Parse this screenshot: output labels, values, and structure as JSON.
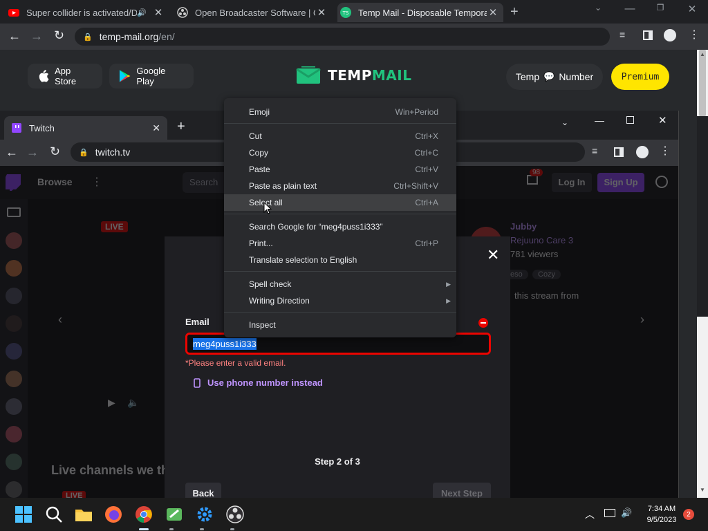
{
  "outer_tabs": [
    {
      "title": "Super collider is activated/De"
    },
    {
      "title": "Open Broadcaster Software | OBS"
    },
    {
      "title": "Temp Mail - Disposable Temporary Email"
    }
  ],
  "outer_url": {
    "host": "temp-mail.org",
    "path": "/en/"
  },
  "tempmail": {
    "app_store": "App Store",
    "google_play": "Google Play",
    "logo_a": "TEMP",
    "logo_b": "MAIL",
    "temp_number_a": "Temp",
    "temp_number_b": "Number",
    "premium": "Premium"
  },
  "inner_tab": {
    "title": "Twitch"
  },
  "inner_url": "twitch.tv",
  "twitch_bg": {
    "browse": "Browse",
    "search": "Search",
    "login": "Log In",
    "signup": "Sign Up",
    "badge": "98",
    "live": "LIVE",
    "streamer": "Jubby",
    "game": "Rejuuno Care 3",
    "viewers": "781 viewers",
    "tag1": "eso",
    "tag2": "Cozy",
    "stream_from": "this stream from",
    "live_channels": "Live channels we th",
    "live_badge2": "LIVE"
  },
  "modal": {
    "email_label": "Email",
    "email_value": "meg4puss1i333",
    "error": "*Please enter a valid email.",
    "phone_link": "Use phone number instead",
    "step": "Step 2 of 3",
    "back": "Back",
    "next": "Next Step"
  },
  "context_menu": [
    {
      "label": "Emoji",
      "shortcut": "Win+Period"
    },
    {
      "label": "Cut",
      "shortcut": "Ctrl+X"
    },
    {
      "label": "Copy",
      "shortcut": "Ctrl+C"
    },
    {
      "label": "Paste",
      "shortcut": "Ctrl+V"
    },
    {
      "label": "Paste as plain text",
      "shortcut": "Ctrl+Shift+V"
    },
    {
      "label": "Select all",
      "shortcut": "Ctrl+A"
    },
    {
      "label": "Search Google for “meg4puss1i333”",
      "shortcut": ""
    },
    {
      "label": "Print...",
      "shortcut": "Ctrl+P"
    },
    {
      "label": "Translate selection to English",
      "shortcut": ""
    },
    {
      "label": "Spell check",
      "shortcut": ""
    },
    {
      "label": "Writing Direction",
      "shortcut": ""
    },
    {
      "label": "Inspect",
      "shortcut": ""
    }
  ],
  "taskbar": {
    "time": "7:34 AM",
    "date": "9/5/2023",
    "notifications": "2"
  },
  "colors": {
    "accent_purple": "#9146ff",
    "tempmail_green": "#21c27e",
    "premium_yellow": "#ffe500",
    "error_red": "#eb0400"
  }
}
